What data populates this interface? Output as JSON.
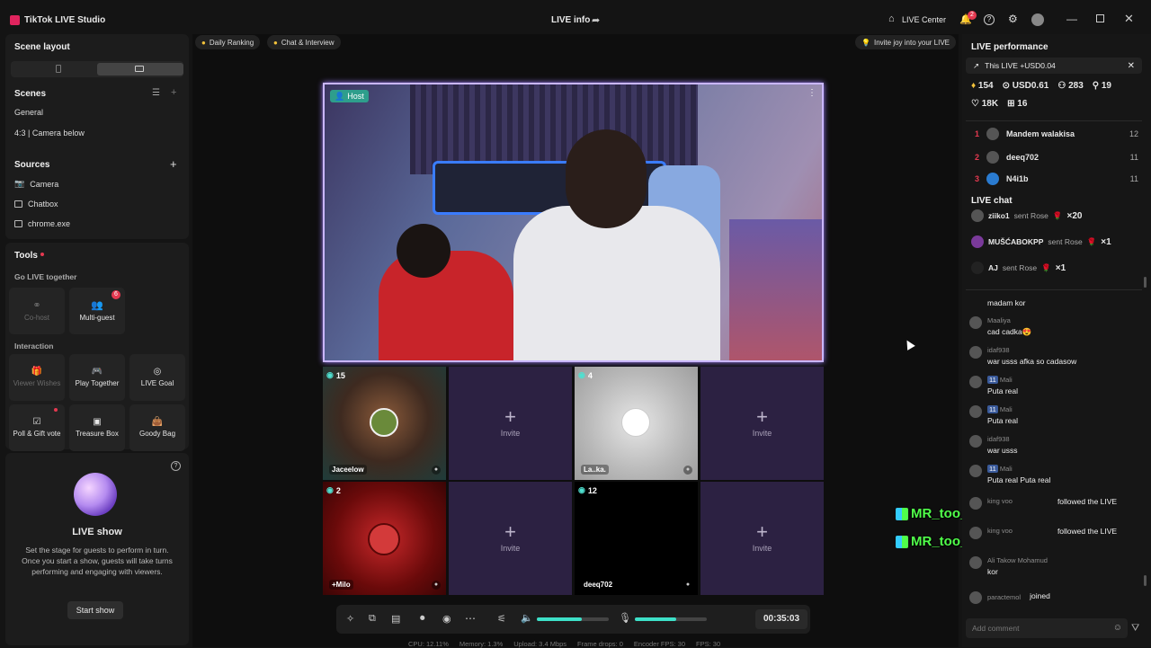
{
  "app": {
    "title": "TikTok LIVE Studio",
    "center_title": "LIVE info",
    "live_center": "LIVE Center",
    "notif_count": "2"
  },
  "left": {
    "scene_layout": "Scene layout",
    "scenes_title": "Scenes",
    "scenes": [
      "General",
      "4:3 | Camera below"
    ],
    "sources_title": "Sources",
    "sources": [
      "Camera",
      "Chatbox",
      "chrome.exe"
    ],
    "tools_title": "Tools",
    "go_live_together": "Go LIVE together",
    "cohost": "Co-host",
    "multiguest": "Multi-guest",
    "multiguest_badge": "6",
    "interaction": "Interaction",
    "viewer_wishes": "Viewer Wishes",
    "play_together": "Play Together",
    "live_goal": "LIVE Goal",
    "poll": "Poll & Gift vote",
    "treasure": "Treasure Box",
    "goody": "Goody Bag",
    "live_show_title": "LIVE show",
    "live_show_desc": "Set the stage for guests to perform in turn. Once you start a show, guests will take turns performing and engaging with viewers.",
    "start_show": "Start show"
  },
  "center": {
    "daily_ranking": "Daily Ranking",
    "chat_interview": "Chat & Interview",
    "invite_joy": "Invite joy into your LIVE",
    "host_label": "Host",
    "guests": [
      {
        "num": "15",
        "name": "Jaceelow"
      },
      {
        "invite": "Invite"
      },
      {
        "num": "4",
        "name": "La..ka."
      },
      {
        "invite": "Invite"
      },
      {
        "num": "2",
        "name": "+Milo"
      },
      {
        "invite": "Invite"
      },
      {
        "num": "12",
        "name": "deeq702"
      },
      {
        "invite": "Invite"
      }
    ],
    "timer": "00:35:03",
    "stats": {
      "cpu": "CPU: 12.11%",
      "memory": "Memory: 1.3%",
      "upload": "Upload: 3.4 Mbps",
      "frame_drops": "Frame drops: 0",
      "encoder_fps": "Encoder FPS: 30",
      "fps": "FPS: 30"
    },
    "volume_level": 0.62,
    "mic_level": 0.58
  },
  "overlay": {
    "name1": "MR_too_FAST",
    "name2": "MR_too_FAST"
  },
  "right": {
    "perf_title": "LIVE performance",
    "this_live": "This LIVE +USD0.04",
    "stats": {
      "diamonds": "154",
      "usd": "USD0.61",
      "viewers": "283",
      "new": "19",
      "likes": "18K",
      "gifts": "16"
    },
    "ranking": [
      {
        "rank": "1",
        "name": "Mandem walakisa",
        "score": "12"
      },
      {
        "rank": "2",
        "name": "deeq702",
        "score": "11"
      },
      {
        "rank": "3",
        "name": "N4i1b",
        "score": "11"
      }
    ],
    "chat_title": "LIVE chat",
    "gifts": [
      {
        "user": "ziiko1",
        "action": "sent Rose",
        "count": "×20"
      },
      {
        "user": "MUŠĆABOKPP",
        "action": "sent Rose",
        "count": "×1"
      },
      {
        "user": "AJ",
        "action": "sent Rose",
        "count": "×1"
      }
    ],
    "messages": [
      {
        "user": "",
        "text": "madam kor"
      },
      {
        "user": "Maaliya",
        "text": "cad cadka😍"
      },
      {
        "user": "idaf938",
        "text": "war usss afka so cadasow"
      },
      {
        "user": "Mali",
        "level": "11",
        "text": "Puta real"
      },
      {
        "user": "Mali",
        "level": "11",
        "text": "Puta real"
      },
      {
        "user": "idaf938",
        "text": "war usss"
      },
      {
        "user": "Mali",
        "level": "11",
        "text": "Puta real Puta real"
      }
    ],
    "follows": [
      {
        "user": "king voo",
        "text": "followed the LIVE"
      },
      {
        "user": "king voo",
        "text": "followed the LIVE"
      }
    ],
    "ali": {
      "user": "Ali Takow Mohamud",
      "text": "kor"
    },
    "joined": {
      "user": "paractemol",
      "text": "joined"
    },
    "add_comment": "Add comment"
  }
}
